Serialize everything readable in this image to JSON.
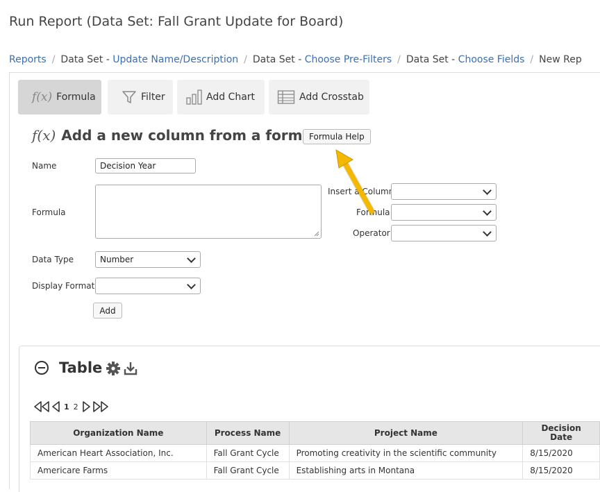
{
  "page": {
    "title": "Run Report (Data Set: Fall Grant Update for Board)"
  },
  "breadcrumb": [
    {
      "prefix": "Reports",
      "link": ""
    },
    {
      "prefix": "Data Set - ",
      "link": "Update Name/Description"
    },
    {
      "prefix": "Data Set - ",
      "link": "Choose Pre-Filters"
    },
    {
      "prefix": "Data Set - ",
      "link": "Choose Fields"
    },
    {
      "prefix": "New Rep",
      "link": ""
    }
  ],
  "toolbar": {
    "formula_icon": "f(x)",
    "formula": "Formula",
    "filter": "Filter",
    "add_chart": "Add Chart",
    "add_crosstab": "Add Crosstab"
  },
  "form": {
    "heading_icon": "f(x)",
    "heading": "Add a new column from a formula.",
    "help_button": "Formula Help",
    "name_label": "Name",
    "name_value": "Decision Year",
    "formula_label": "Formula",
    "insert_column_label": "Insert a Column",
    "formula_select_label": "Formula",
    "operator_label": "Operator",
    "data_type_label": "Data Type",
    "data_type_value": "Number",
    "display_format_label": "Display Format",
    "display_format_value": "",
    "add_button": "Add"
  },
  "table": {
    "title": "Table",
    "pager": {
      "page1": "1",
      "page2": "2"
    },
    "columns": [
      "Organization Name",
      "Process Name",
      "Project Name",
      "Decision Date"
    ],
    "rows": [
      [
        "American Heart Association, Inc.",
        "Fall Grant Cycle",
        "Promoting creativity in the scientific community",
        "8/15/2020"
      ],
      [
        "Americare Farms",
        "Fall Grant Cycle",
        "Establishing arts in Montana",
        "8/15/2020"
      ]
    ]
  },
  "colors": {
    "link": "#3a6fb0",
    "annotation_arrow": "#f5b800"
  },
  "icons": [
    "fx-icon",
    "filter-icon",
    "bar-chart-icon",
    "crosstab-icon",
    "gear-icon",
    "download-icon",
    "collapse-icon",
    "first-page-icon",
    "prev-page-icon",
    "next-page-icon",
    "last-page-icon",
    "arrow-annotation-icon"
  ]
}
